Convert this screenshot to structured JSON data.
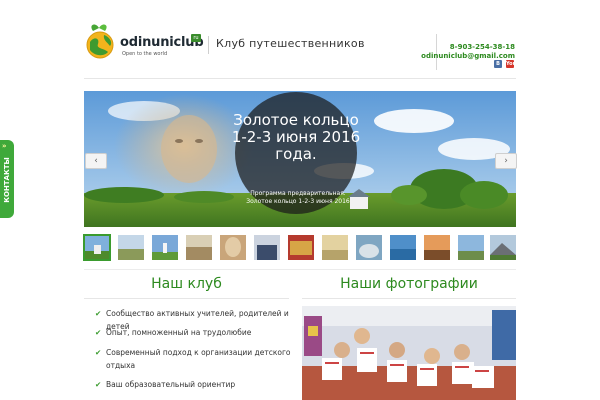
{
  "header": {
    "logo_name": "odinuniclub",
    "logo_badge": "ru",
    "logo_tagline": "Open to the world",
    "club_title": "Клуб путешественников",
    "phone": "8-903-254-38-18",
    "email": "odinuniclub@gmail.com",
    "social": {
      "vk": "В",
      "youtube": "You"
    }
  },
  "side_tab": {
    "label": "КОНТАКТЫ",
    "chevron": "»"
  },
  "slider": {
    "title": "Золотое кольцо 1-2-3 июня 2016 года.",
    "subtitle": "Программа предварительная. Золотое кольцо 1-2-3 июня 2016",
    "prev": "‹",
    "next": "›",
    "thumbnail_count": 13
  },
  "sections": {
    "club": {
      "title": "Наш клуб",
      "items": [
        "Сообщество активных учителей, родителей и детей",
        "Опыт, помноженный на трудолюбие",
        "Современный подход к организации детского отдыха",
        "Ваш образовательный ориентир"
      ]
    },
    "photos": {
      "title": "Наши фотографии"
    }
  },
  "colors": {
    "accent": "#2d8a1f",
    "tab": "#3fa93a"
  }
}
